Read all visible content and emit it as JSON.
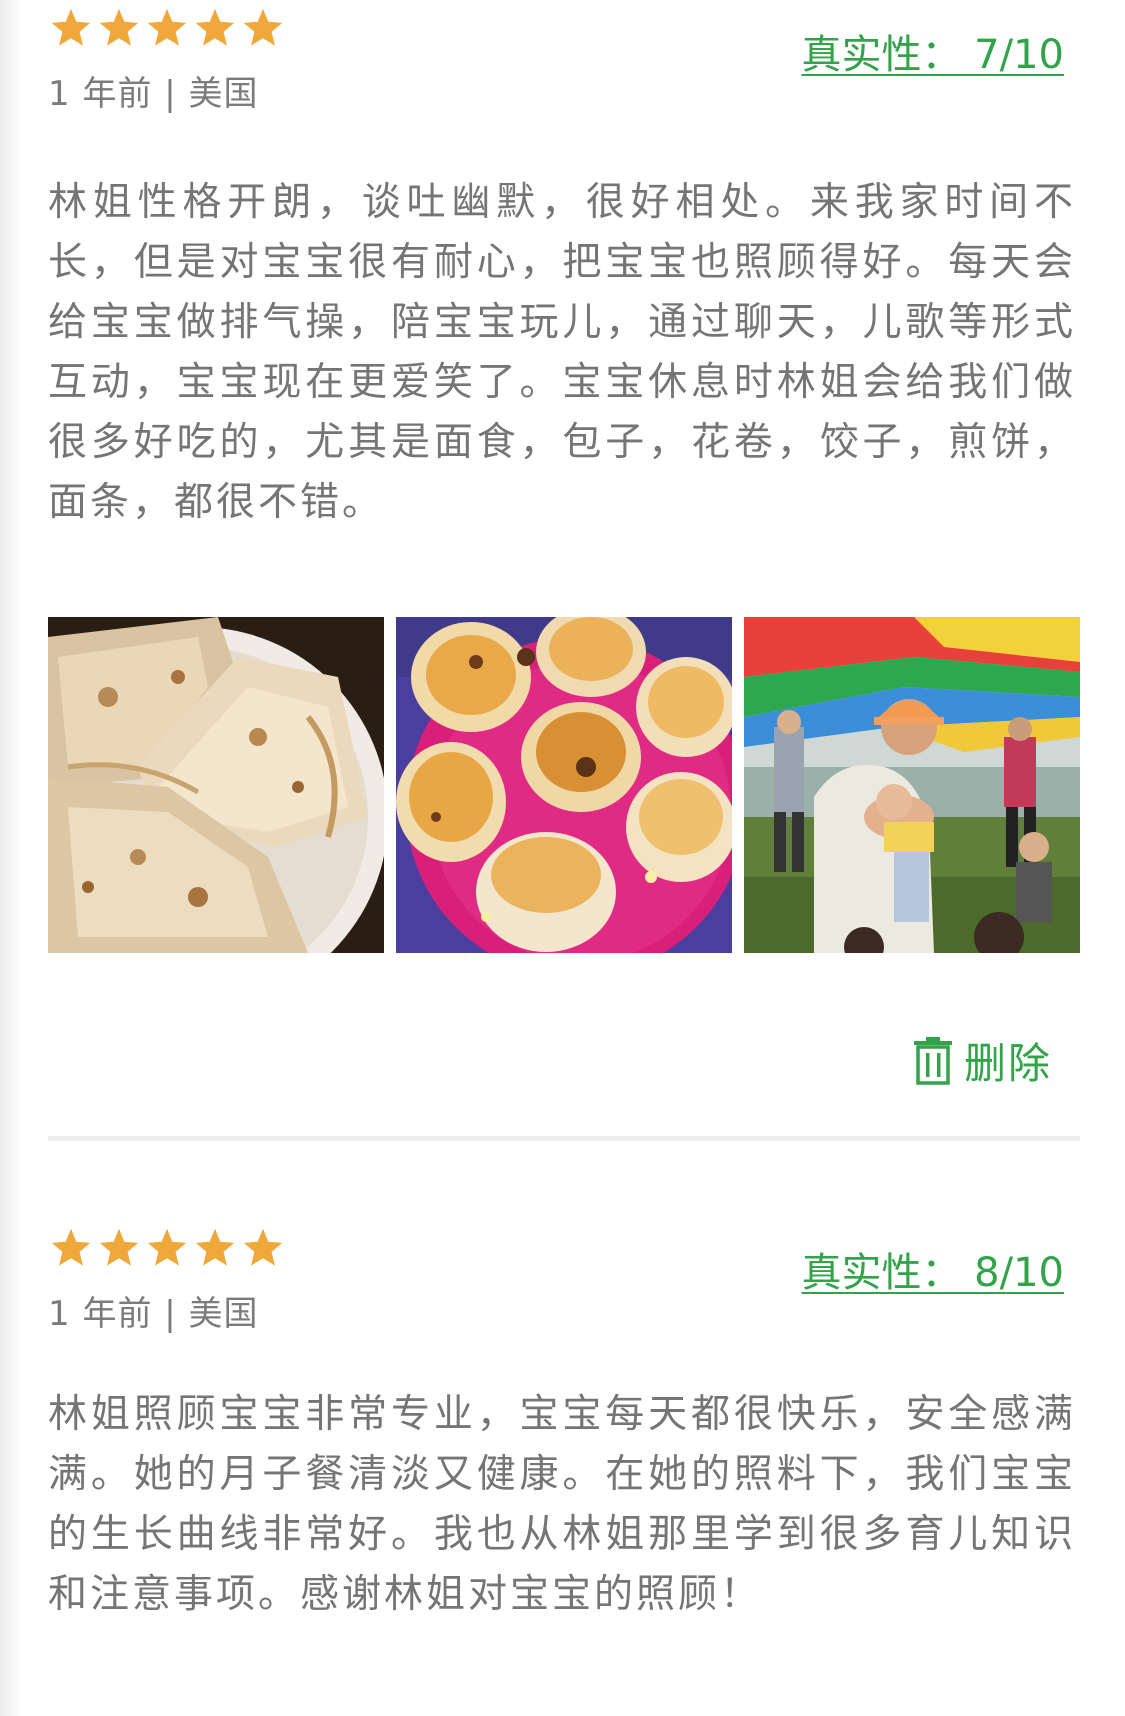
{
  "colors": {
    "star": "#f0a83b",
    "accent_green": "#33a34a",
    "text_gray": "#757575",
    "meta_gray": "#7b7b7b",
    "divider": "#eeeeee"
  },
  "reviews": [
    {
      "rating": 5,
      "meta": "1 年前 | 美国",
      "authenticity": "真实性： 7/10",
      "text": "林姐性格开朗，谈吐幽默，很好相处。来我家时间不长，但是对宝宝很有耐心，把宝宝也照顾得好。每天会给宝宝做排气操，陪宝宝玩儿，通过聊天，儿歌等形式互动，宝宝现在更爱笑了。宝宝休息时林姐会给我们做很多好吃的，尤其是面食，包子，花卷，饺子，煎饼，面条，都很不错。",
      "photos": [
        "dumplings-photo",
        "baozi-photo",
        "playground-photo"
      ],
      "delete_label": "删除",
      "delete_icon": "trash-icon"
    },
    {
      "rating": 5,
      "meta": "1 年前 | 美国",
      "authenticity": "真实性： 8/10",
      "text": "林姐照顾宝宝非常专业，宝宝每天都很快乐，安全感满满。她的月子餐清淡又健康。在她的照料下，我们宝宝的生长曲线非常好。我也从林姐那里学到很多育儿知识和注意事项。感谢林姐对宝宝的照顾！"
    }
  ]
}
